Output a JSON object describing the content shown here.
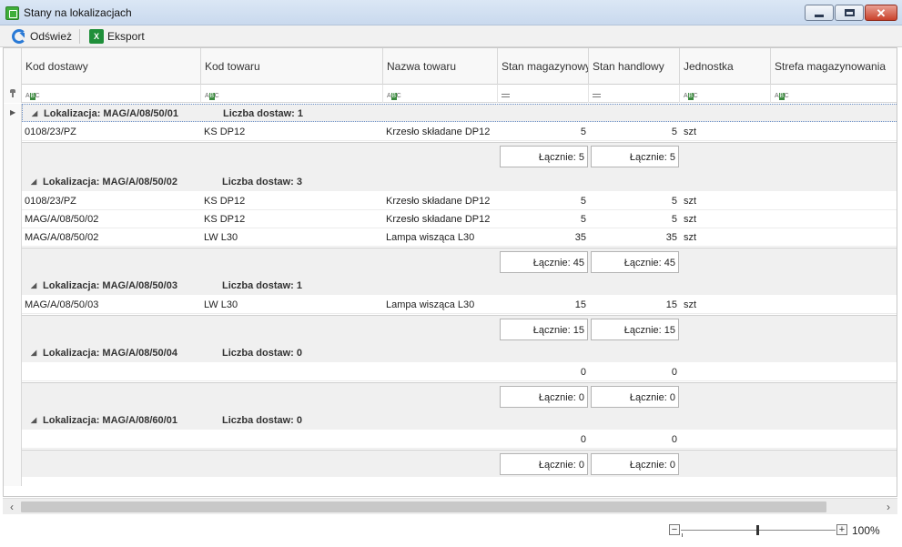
{
  "window": {
    "title": "Stany na lokalizacjach",
    "app_icon": "app-icon",
    "controls": [
      "minimize",
      "maximize",
      "close"
    ]
  },
  "toolbar": {
    "refresh_label": "Odśwież",
    "export_label": "Eksport"
  },
  "columns": [
    "Kod dostawy",
    "Kod towaru",
    "Nazwa towaru",
    "Stan magazynowy",
    "Stan handlowy",
    "Jednostka",
    "Strefa magazynowania"
  ],
  "groups": [
    {
      "location": "Lokalizacja: MAG/A/08/50/01",
      "count": "Liczba dostaw: 1",
      "rows": [
        {
          "kod_dostawy": "0108/23/PZ",
          "kod_towaru": "KS DP12",
          "nazwa": "Krzesło składane DP12",
          "stan_mag": "5",
          "stan_handl": "5",
          "jednostka": "szt",
          "strefa": ""
        }
      ],
      "sum_mag": "Łącznie: 5",
      "sum_handl": "Łącznie: 5"
    },
    {
      "location": "Lokalizacja: MAG/A/08/50/02",
      "count": "Liczba dostaw: 3",
      "rows": [
        {
          "kod_dostawy": "0108/23/PZ",
          "kod_towaru": "KS DP12",
          "nazwa": "Krzesło składane DP12",
          "stan_mag": "5",
          "stan_handl": "5",
          "jednostka": "szt",
          "strefa": ""
        },
        {
          "kod_dostawy": "MAG/A/08/50/02",
          "kod_towaru": "KS DP12",
          "nazwa": "Krzesło składane DP12",
          "stan_mag": "5",
          "stan_handl": "5",
          "jednostka": "szt",
          "strefa": ""
        },
        {
          "kod_dostawy": "MAG/A/08/50/02",
          "kod_towaru": "LW L30",
          "nazwa": "Lampa wisząca L30",
          "stan_mag": "35",
          "stan_handl": "35",
          "jednostka": "szt",
          "strefa": ""
        }
      ],
      "sum_mag": "Łącznie: 45",
      "sum_handl": "Łącznie: 45"
    },
    {
      "location": "Lokalizacja: MAG/A/08/50/03",
      "count": "Liczba dostaw: 1",
      "rows": [
        {
          "kod_dostawy": "MAG/A/08/50/03",
          "kod_towaru": "LW L30",
          "nazwa": "Lampa wisząca L30",
          "stan_mag": "15",
          "stan_handl": "15",
          "jednostka": "szt",
          "strefa": ""
        }
      ],
      "sum_mag": "Łącznie: 15",
      "sum_handl": "Łącznie: 15"
    },
    {
      "location": "Lokalizacja: MAG/A/08/50/04",
      "count": "Liczba dostaw: 0",
      "rows": [
        {
          "kod_dostawy": "",
          "kod_towaru": "",
          "nazwa": "",
          "stan_mag": "0",
          "stan_handl": "0",
          "jednostka": "",
          "strefa": ""
        }
      ],
      "sum_mag": "Łącznie: 0",
      "sum_handl": "Łącznie: 0"
    },
    {
      "location": "Lokalizacja: MAG/A/08/60/01",
      "count": "Liczba dostaw: 0",
      "rows": [
        {
          "kod_dostawy": "",
          "kod_towaru": "",
          "nazwa": "",
          "stan_mag": "0",
          "stan_handl": "0",
          "jednostka": "",
          "strefa": ""
        }
      ],
      "sum_mag": "Łącznie: 0",
      "sum_handl": "Łącznie: 0"
    }
  ],
  "zoom": {
    "label": "100%",
    "minus": "−",
    "plus": "+"
  }
}
